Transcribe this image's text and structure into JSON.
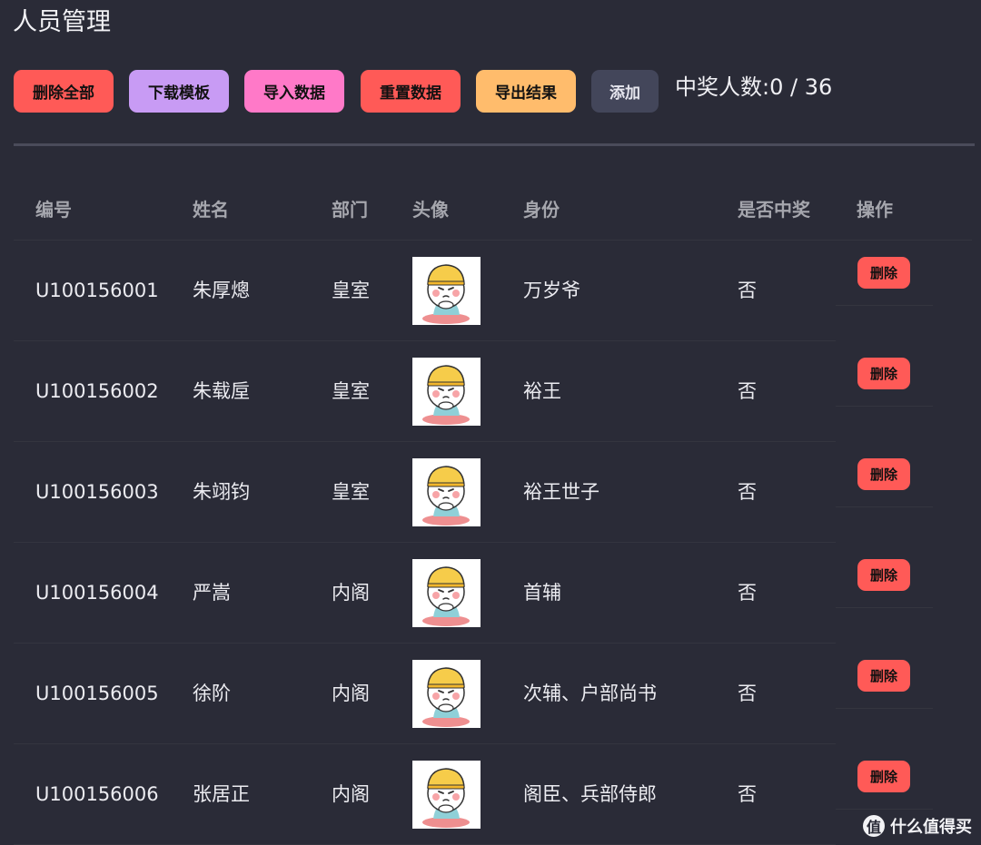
{
  "header": {
    "title": "人员管理"
  },
  "toolbar": {
    "delete_all": "删除全部",
    "download_template": "下载模板",
    "import_data": "导入数据",
    "reset_data": "重置数据",
    "export_results": "导出结果",
    "add": "添加",
    "winner_count": "中奖人数:0 / 36"
  },
  "table": {
    "columns": [
      "编号",
      "姓名",
      "部门",
      "头像",
      "身份",
      "是否中奖",
      "操作"
    ],
    "rows": [
      {
        "id": "U100156001",
        "name": "朱厚熜",
        "dept": "皇室",
        "role": "万岁爷",
        "winner": "否",
        "action": "删除"
      },
      {
        "id": "U100156002",
        "name": "朱载垕",
        "dept": "皇室",
        "role": "裕王",
        "winner": "否",
        "action": "删除"
      },
      {
        "id": "U100156003",
        "name": "朱翊钧",
        "dept": "皇室",
        "role": "裕王世子",
        "winner": "否",
        "action": "删除"
      },
      {
        "id": "U100156004",
        "name": "严嵩",
        "dept": "内阁",
        "role": "首辅",
        "winner": "否",
        "action": "删除"
      },
      {
        "id": "U100156005",
        "name": "徐阶",
        "dept": "内阁",
        "role": "次辅、户部尚书",
        "winner": "否",
        "action": "删除"
      },
      {
        "id": "U100156006",
        "name": "张居正",
        "dept": "内阁",
        "role": "阁臣、兵部侍郎",
        "winner": "否",
        "action": "删除"
      }
    ]
  },
  "watermark": {
    "icon": "值",
    "text": "什么值得买"
  },
  "colors": {
    "background": "#2a2b37",
    "red": "#ff5a57",
    "purple": "#c89bf4",
    "pink": "#ff79c8",
    "orange": "#ffbc6c",
    "dark_button": "#43465a"
  }
}
